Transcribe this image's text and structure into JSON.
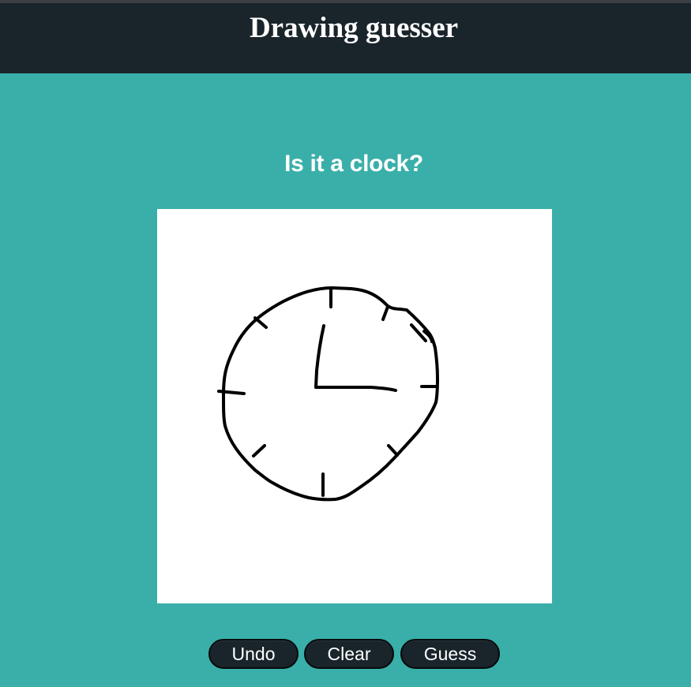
{
  "header": {
    "title": "Drawing guesser"
  },
  "result": {
    "guess_text": "Is it a clock?"
  },
  "canvas": {
    "content": "hand-drawn clock sketch"
  },
  "toolbar": {
    "undo_label": "Undo",
    "clear_label": "Clear",
    "guess_label": "Guess"
  },
  "colors": {
    "background": "#3aafa9",
    "header_bg": "#19242b",
    "button_bg": "#19242b",
    "text": "#ffffff",
    "ink": "#000000"
  }
}
